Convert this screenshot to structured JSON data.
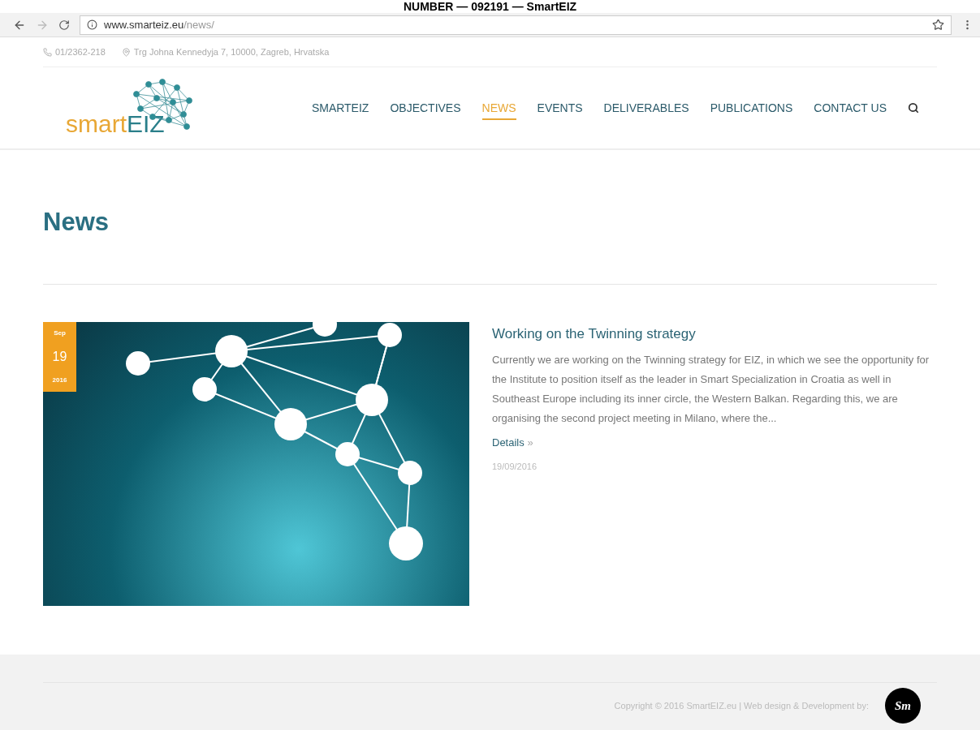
{
  "caption": "NUMBER — 092191 — SmartEIZ",
  "browser": {
    "url_host": "www.smarteiz.eu",
    "url_path": "/news/"
  },
  "topbar": {
    "phone": "01/2362-218",
    "address": "Trg Johna Kennedyja 7, 10000, Zagreb, Hrvatska"
  },
  "logo": {
    "part_1": "smart",
    "part_2": "EIZ"
  },
  "nav": [
    {
      "label": "SMARTEIZ",
      "selected": false
    },
    {
      "label": "OBJECTIVES",
      "selected": false
    },
    {
      "label": "NEWS",
      "selected": true
    },
    {
      "label": "EVENTS",
      "selected": false
    },
    {
      "label": "DELIVERABLES",
      "selected": false
    },
    {
      "label": "PUBLICATIONS",
      "selected": false
    },
    {
      "label": "CONTACT US",
      "selected": false
    }
  ],
  "page_title": "News",
  "posts": [
    {
      "month": "Sep",
      "day": "19",
      "year": "2016",
      "title": "Working on the Twinning strategy",
      "excerpt": "Currently we are working on the Twinning strategy for EIZ, in which we see the opportunity for the Institute to position itself as the leader in Smart Specialization in Croatia as well in Southeast Europe including its inner circle, the Western Balkan. Regarding this, we are organising the second project meeting in Milano, where the...",
      "details": "Details",
      "details_icon": "»",
      "date": "19/09/2016"
    }
  ],
  "footer": {
    "copyright": "Copyright © 2016 SmartEIZ.eu | Web design & Development by:",
    "badge": "Sm"
  }
}
